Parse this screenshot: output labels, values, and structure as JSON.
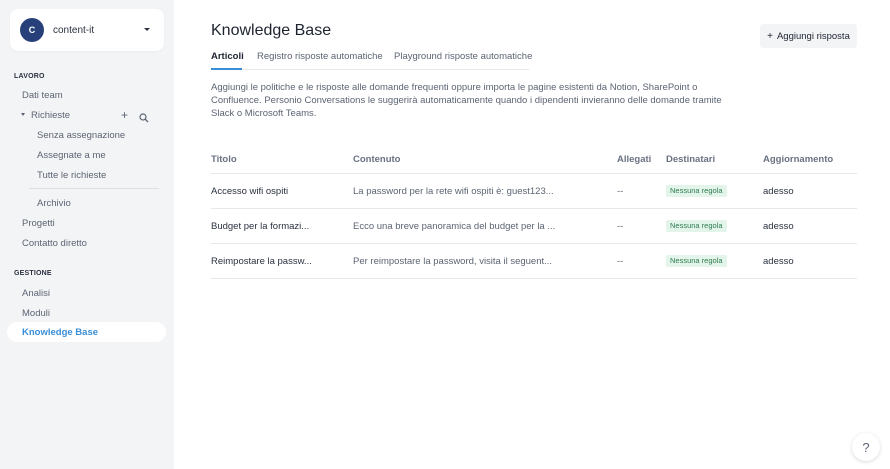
{
  "workspace": {
    "avatar_initial": "C",
    "name": "content-it"
  },
  "sidebar": {
    "section_work": "LAVORO",
    "team_data": "Dati team",
    "requests": "Richieste",
    "unassigned": "Senza assegnazione",
    "assigned_to_me": "Assegnate a me",
    "all_requests": "Tutte le richieste",
    "archive": "Archivio",
    "projects": "Progetti",
    "direct_contact": "Contatto diretto",
    "section_management": "GESTIONE",
    "analytics": "Analisi",
    "forms": "Moduli",
    "knowledge_base": "Knowledge Base"
  },
  "header": {
    "title": "Knowledge Base",
    "add_button_label": "Aggiungi risposta"
  },
  "tabs": [
    {
      "label": "Articoli"
    },
    {
      "label": "Registro risposte automatiche"
    },
    {
      "label": "Playground risposte automatiche"
    }
  ],
  "description": "Aggiungi le politiche e le risposte alle domande frequenti oppure importa le pagine esistenti da Notion, SharePoint o Confluence. Personio Conversations le suggerirà automaticamente quando i dipendenti invieranno delle domande tramite Slack o Microsoft Teams.",
  "table": {
    "columns": [
      "Titolo",
      "Contenuto",
      "Allegati",
      "Destinatari",
      "Aggiornamento"
    ],
    "rows": [
      {
        "title": "Accesso wifi ospiti",
        "content": "La password per la rete wifi ospiti è: guest123...",
        "attachments": "--",
        "recipients": "Nessuna regola",
        "updated": "adesso"
      },
      {
        "title": "Budget per la formazi...",
        "content": "Ecco una breve panoramica del budget per la ...",
        "attachments": "--",
        "recipients": "Nessuna regola",
        "updated": "adesso"
      },
      {
        "title": "Reimpostare la passw...",
        "content": "Per reimpostare la password, visita il seguent...",
        "attachments": "--",
        "recipients": "Nessuna regola",
        "updated": "adesso"
      }
    ]
  },
  "help": {
    "label": "?"
  },
  "colors": {
    "accent": "#3a8ed6",
    "avatar": "#27407a",
    "badge_bg": "#e3f4ea",
    "badge_text": "#2e7d4f"
  }
}
